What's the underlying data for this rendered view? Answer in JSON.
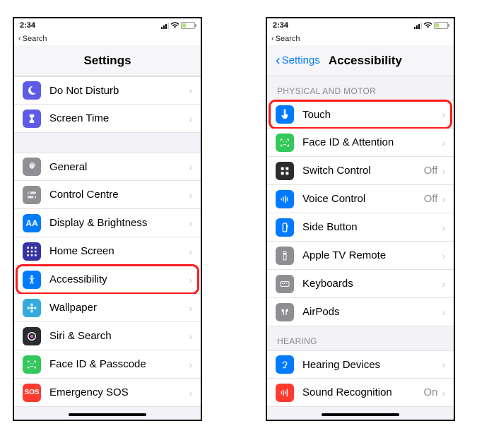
{
  "status": {
    "time": "2:34"
  },
  "back_search": "Search",
  "left": {
    "title": "Settings",
    "rows_top": [
      {
        "icon": "moon",
        "bg": "#5e5ce6",
        "label": "Do Not Disturb"
      },
      {
        "icon": "hourglass",
        "bg": "#5e5ce6",
        "label": "Screen Time"
      }
    ],
    "rows_main": [
      {
        "icon": "gear",
        "bg": "#8e8e93",
        "label": "General"
      },
      {
        "icon": "switches",
        "bg": "#8e8e93",
        "label": "Control Centre"
      },
      {
        "icon": "aa",
        "bg": "#007aff",
        "label": "Display & Brightness"
      },
      {
        "icon": "grid",
        "bg": "#3634a3",
        "label": "Home Screen"
      },
      {
        "icon": "access",
        "bg": "#007aff",
        "label": "Accessibility",
        "highlight": true
      },
      {
        "icon": "flower",
        "bg": "#34aadc",
        "label": "Wallpaper"
      },
      {
        "icon": "siri",
        "bg": "#2c2c2e",
        "label": "Siri & Search"
      },
      {
        "icon": "faceid",
        "bg": "#34c759",
        "label": "Face ID & Passcode"
      },
      {
        "icon": "sos",
        "bg": "#ff3b30",
        "label": "Emergency SOS"
      }
    ]
  },
  "right": {
    "back": "Settings",
    "title": "Accessibility",
    "section1": "PHYSICAL AND MOTOR",
    "section2": "HEARING",
    "rows1": [
      {
        "icon": "touch",
        "bg": "#007aff",
        "label": "Touch",
        "highlight": true
      },
      {
        "icon": "faceid",
        "bg": "#34c759",
        "label": "Face ID & Attention"
      },
      {
        "icon": "switch",
        "bg": "#2c2c2e",
        "label": "Switch Control",
        "detail": "Off"
      },
      {
        "icon": "voice",
        "bg": "#007aff",
        "label": "Voice Control",
        "detail": "Off"
      },
      {
        "icon": "side",
        "bg": "#007aff",
        "label": "Side Button"
      },
      {
        "icon": "tvremote",
        "bg": "#8e8e93",
        "label": "Apple TV Remote"
      },
      {
        "icon": "keyboard",
        "bg": "#8e8e93",
        "label": "Keyboards"
      },
      {
        "icon": "airpods",
        "bg": "#8e8e93",
        "label": "AirPods"
      }
    ],
    "rows2": [
      {
        "icon": "ear",
        "bg": "#007aff",
        "label": "Hearing Devices"
      },
      {
        "icon": "soundrec",
        "bg": "#ff3b30",
        "label": "Sound Recognition",
        "detail": "On"
      }
    ]
  }
}
